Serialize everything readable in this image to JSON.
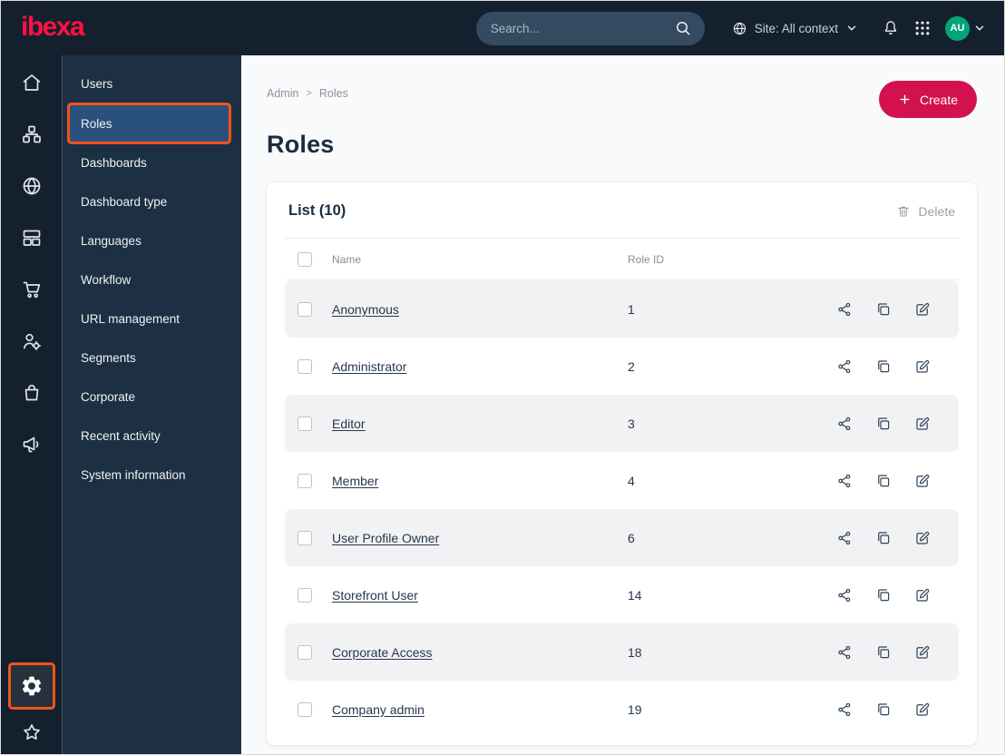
{
  "topbar": {
    "logo": "ibexa",
    "search": {
      "placeholder": "Search..."
    },
    "site_context": "Site: All context",
    "avatar_initials": "AU"
  },
  "icon_rail": {
    "items": [
      "home",
      "content-structure",
      "site",
      "storage",
      "commerce",
      "personalization",
      "product-catalog",
      "promotions"
    ],
    "bottom_items": [
      "admin-settings",
      "bookmarks"
    ]
  },
  "sidebar": {
    "items": [
      {
        "label": "Users",
        "active": false
      },
      {
        "label": "Roles",
        "active": true
      },
      {
        "label": "Dashboards",
        "active": false
      },
      {
        "label": "Dashboard type",
        "active": false
      },
      {
        "label": "Languages",
        "active": false
      },
      {
        "label": "Workflow",
        "active": false
      },
      {
        "label": "URL management",
        "active": false
      },
      {
        "label": "Segments",
        "active": false
      },
      {
        "label": "Corporate",
        "active": false
      },
      {
        "label": "Recent activity",
        "active": false
      },
      {
        "label": "System information",
        "active": false
      }
    ]
  },
  "main": {
    "breadcrumb": {
      "items": [
        "Admin",
        "Roles"
      ],
      "separator": ">"
    },
    "create_button": "Create",
    "page_title": "Roles",
    "card": {
      "list_title": "List (10)",
      "delete_button": "Delete",
      "columns": {
        "name": "Name",
        "role_id": "Role ID"
      },
      "rows": [
        {
          "name": "Anonymous",
          "role_id": "1"
        },
        {
          "name": "Administrator",
          "role_id": "2"
        },
        {
          "name": "Editor",
          "role_id": "3"
        },
        {
          "name": "Member",
          "role_id": "4"
        },
        {
          "name": "User Profile Owner",
          "role_id": "6"
        },
        {
          "name": "Storefront User",
          "role_id": "14"
        },
        {
          "name": "Corporate Access",
          "role_id": "18"
        },
        {
          "name": "Company admin",
          "role_id": "19"
        }
      ]
    }
  },
  "colors": {
    "brand_red": "#ff1043",
    "create_button_bg": "#d2114e",
    "annotation_highlight": "#f4511e",
    "active_menu_bg": "#2a517c",
    "avatar_bg": "#00a678",
    "navy_bg": "#14202e"
  }
}
